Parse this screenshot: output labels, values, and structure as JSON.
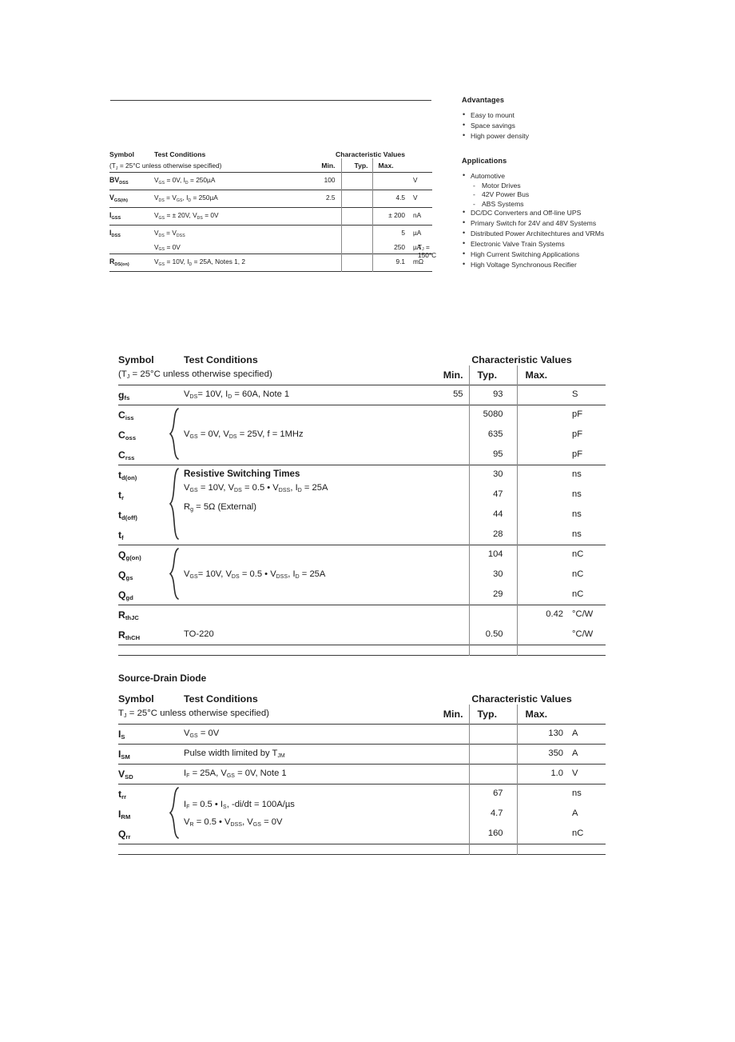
{
  "page": {
    "background": "#ffffff",
    "text_color": "#1b1b1b",
    "rule_color": "#3a3a3a"
  },
  "sidebar": {
    "advantages_heading": "Advantages",
    "advantages": [
      "Easy to mount",
      "Space savings",
      "High power density"
    ],
    "applications_heading": "Applications",
    "applications": [
      {
        "label": "Automotive",
        "sub": [
          "Motor Drives",
          "42V Power Bus",
          "ABS Systems"
        ]
      },
      {
        "label": "DC/DC Converters and Off-line UPS",
        "sub": []
      },
      {
        "label": "Primary Switch for 24V and 48V Systems",
        "sub": []
      },
      {
        "label": "Distributed Power Architechtures and VRMs",
        "sub": []
      },
      {
        "label": "Electronic Valve Train Systems",
        "sub": []
      },
      {
        "label": "High Current Switching Applications",
        "sub": []
      },
      {
        "label": "High Voltage Synchronous Recifier",
        "sub": []
      }
    ]
  },
  "table_small": {
    "header": {
      "symbol": "Symbol",
      "test_conditions": "Test Conditions",
      "subnote_pre": "(T",
      "subnote_sub": "J",
      "subnote_post": " = 25°C unless otherwise specified)",
      "characteristic_values": "Characteristic Values",
      "min": "Min.",
      "typ": "Typ.",
      "max": "Max."
    },
    "rows": [
      {
        "symbol_main": "BV",
        "symbol_sub": "DSS",
        "conditions": [
          {
            "segments": [
              {
                "t": "V",
                "sub": "GS"
              },
              {
                "t": " = 0V, "
              },
              {
                "t": "I",
                "sub": "D"
              },
              {
                "t": " = 250µA"
              }
            ],
            "right": ""
          }
        ],
        "min": "100",
        "typ": "",
        "max": "",
        "unit": "V"
      },
      {
        "symbol_main": "V",
        "symbol_sub": "GS(th)",
        "conditions": [
          {
            "segments": [
              {
                "t": "V",
                "sub": "DS"
              },
              {
                "t": " = V"
              },
              {
                "t": "",
                "sub": "GS"
              },
              {
                "t": ", "
              },
              {
                "t": "I",
                "sub": "D"
              },
              {
                "t": " = 250µA"
              }
            ],
            "right": ""
          }
        ],
        "min": "2.5",
        "typ": "",
        "max": "4.5",
        "unit": "V"
      },
      {
        "symbol_main": "I",
        "symbol_sub": "GSS",
        "conditions": [
          {
            "segments": [
              {
                "t": "V",
                "sub": "GS"
              },
              {
                "t": " = ± 20V, "
              },
              {
                "t": "V",
                "sub": "DS"
              },
              {
                "t": " = 0V"
              }
            ],
            "right": ""
          }
        ],
        "min": "",
        "typ": "",
        "max": "± 200",
        "unit": "nA"
      },
      {
        "symbol_main": "I",
        "symbol_sub": "DSS",
        "conditions": [
          {
            "segments": [
              {
                "t": "V",
                "sub": "DS"
              },
              {
                "t": " =  V"
              },
              {
                "t": "",
                "sub": "DSS"
              }
            ],
            "right": ""
          },
          {
            "segments": [
              {
                "t": "V",
                "sub": "GS"
              },
              {
                "t": " = 0V"
              }
            ],
            "right_segments": [
              {
                "t": "T",
                "sub": "J"
              },
              {
                "t": " = 150°C"
              }
            ]
          }
        ],
        "min": "",
        "typ": "",
        "max": "5",
        "max2": "250",
        "unit": "µA",
        "unit2": "µA"
      },
      {
        "symbol_main": "R",
        "symbol_sub": "DS(on)",
        "conditions": [
          {
            "segments": [
              {
                "t": "V",
                "sub": "GS"
              },
              {
                "t": " = 10V, "
              },
              {
                "t": "I",
                "sub": "D"
              },
              {
                "t": " = 25A, Notes 1, 2"
              }
            ],
            "right": ""
          }
        ],
        "min": "",
        "typ": "",
        "max": "9.1",
        "unit": "mΩ"
      }
    ]
  },
  "table_main": {
    "header": {
      "symbol": "Symbol",
      "test_conditions": "Test Conditions",
      "subnote_pre": "(T",
      "subnote_sub": "J",
      "subnote_post": " = 25°C unless otherwise specified)",
      "characteristic_values": "Characteristic Values",
      "min": "Min.",
      "typ": "Typ.",
      "max": "Max."
    },
    "groups": [
      {
        "braced": false,
        "rows": [
          {
            "symbol_main": "g",
            "symbol_sub": "fs",
            "min": "55",
            "typ": "93",
            "max": "",
            "unit": "S"
          }
        ],
        "conditions": [
          {
            "segments": [
              {
                "t": "V",
                "sub": "DS"
              },
              {
                "t": "= 10V, "
              },
              {
                "t": "I",
                "sub": "D"
              },
              {
                "t": " = 60A, Note 1"
              }
            ]
          }
        ]
      },
      {
        "braced": true,
        "rows": [
          {
            "symbol_main": "C",
            "symbol_sub": "iss",
            "min": "",
            "typ": "5080",
            "max": "",
            "unit": "pF"
          },
          {
            "symbol_main": "C",
            "symbol_sub": "oss",
            "min": "",
            "typ": "635",
            "max": "",
            "unit": "pF"
          },
          {
            "symbol_main": "C",
            "symbol_sub": "rss",
            "min": "",
            "typ": "95",
            "max": "",
            "unit": "pF"
          }
        ],
        "conditions": [
          {
            "segments": [
              {
                "t": "V",
                "sub": "GS"
              },
              {
                "t": " = 0V, "
              },
              {
                "t": "V",
                "sub": "DS"
              },
              {
                "t": " = 25V, f = 1MHz"
              }
            ]
          }
        ]
      },
      {
        "braced": true,
        "section_title": "Resistive Switching Times",
        "rows": [
          {
            "symbol_main": "t",
            "symbol_sub": "d(on)",
            "min": "",
            "typ": "30",
            "max": "",
            "unit": "ns"
          },
          {
            "symbol_main": "t",
            "symbol_sub": "r",
            "min": "",
            "typ": "47",
            "max": "",
            "unit": "ns"
          },
          {
            "symbol_main": "t",
            "symbol_sub": "d(off)",
            "min": "",
            "typ": "44",
            "max": "",
            "unit": "ns"
          },
          {
            "symbol_main": "t",
            "symbol_sub": "f",
            "min": "",
            "typ": "28",
            "max": "",
            "unit": "ns"
          }
        ],
        "conditions": [
          {
            "segments": [
              {
                "t": "V",
                "sub": "GS"
              },
              {
                "t": " = 10V, "
              },
              {
                "t": "V",
                "sub": "DS"
              },
              {
                "t": " = 0.5 • V"
              },
              {
                "t": "",
                "sub": "DSS"
              },
              {
                "t": ", "
              },
              {
                "t": "I",
                "sub": "D"
              },
              {
                "t": " = 25A"
              }
            ]
          },
          {
            "segments": [
              {
                "t": "R",
                "sub": "g"
              },
              {
                "t": " = 5Ω (External)"
              }
            ]
          }
        ]
      },
      {
        "braced": true,
        "rows": [
          {
            "symbol_main": "Q",
            "symbol_sub": "g(on)",
            "min": "",
            "typ": "104",
            "max": "",
            "unit": "nC"
          },
          {
            "symbol_main": "Q",
            "symbol_sub": "gs",
            "min": "",
            "typ": "30",
            "max": "",
            "unit": "nC"
          },
          {
            "symbol_main": "Q",
            "symbol_sub": "gd",
            "min": "",
            "typ": "29",
            "max": "",
            "unit": "nC"
          }
        ],
        "conditions": [
          {
            "segments": [
              {
                "t": "V",
                "sub": "GS"
              },
              {
                "t": "= 10V, "
              },
              {
                "t": "V",
                "sub": "DS"
              },
              {
                "t": " = 0.5 • V"
              },
              {
                "t": "",
                "sub": "DSS"
              },
              {
                "t": ", "
              },
              {
                "t": "I",
                "sub": "D"
              },
              {
                "t": " = 25A"
              }
            ]
          }
        ]
      },
      {
        "braced": false,
        "rows": [
          {
            "symbol_main": "R",
            "symbol_sub": "thJC",
            "min": "",
            "typ": "",
            "max": "0.42",
            "unit": "°C/W",
            "plain_condition": ""
          },
          {
            "symbol_main": "R",
            "symbol_sub": "thCH",
            "min": "",
            "typ": "0.50",
            "max": "",
            "unit": "°C/W",
            "plain_condition": "TO-220"
          }
        ],
        "conditions": []
      }
    ]
  },
  "table_diode": {
    "title": "Source-Drain Diode",
    "header": {
      "symbol": "Symbol",
      "test_conditions": "Test Conditions",
      "subnote_pre": "T",
      "subnote_sub": "J",
      "subnote_post": " = 25°C unless otherwise specified)",
      "characteristic_values": "Characteristic Values",
      "min": "Min.",
      "typ": "Typ.",
      "max": "Max."
    },
    "groups": [
      {
        "braced": false,
        "rows": [
          {
            "symbol_main": "I",
            "symbol_sub": "S",
            "min": "",
            "typ": "",
            "max": "130",
            "unit": "A"
          }
        ],
        "conditions": [
          {
            "segments": [
              {
                "t": "V",
                "sub": "GS"
              },
              {
                "t": " = 0V"
              }
            ]
          }
        ]
      },
      {
        "braced": false,
        "rows": [
          {
            "symbol_main": "I",
            "symbol_sub": "SM",
            "min": "",
            "typ": "",
            "max": "350",
            "unit": "A"
          }
        ],
        "conditions": [
          {
            "segments": [
              {
                "t": "Pulse width limited by T"
              },
              {
                "t": "",
                "sub": "JM"
              }
            ]
          }
        ]
      },
      {
        "braced": false,
        "rows": [
          {
            "symbol_main": "V",
            "symbol_sub": "SD",
            "min": "",
            "typ": "",
            "max": "1.0",
            "unit": "V"
          }
        ],
        "conditions": [
          {
            "segments": [
              {
                "t": "I",
                "sub": "F"
              },
              {
                "t": " = 25A, "
              },
              {
                "t": "V",
                "sub": "GS"
              },
              {
                "t": " = 0V, Note 1"
              }
            ]
          }
        ]
      },
      {
        "braced": true,
        "rows": [
          {
            "symbol_main": "t",
            "symbol_sub": "rr",
            "min": "",
            "typ": "67",
            "max": "",
            "unit": "ns"
          },
          {
            "symbol_main": "I",
            "symbol_sub": "RM",
            "min": "",
            "typ": "4.7",
            "max": "",
            "unit": "A"
          },
          {
            "symbol_main": "Q",
            "symbol_sub": "rr",
            "min": "",
            "typ": "160",
            "max": "",
            "unit": "nC"
          }
        ],
        "conditions": [
          {
            "segments": [
              {
                "t": "I",
                "sub": "F"
              },
              {
                "t": " = 0.5 • I"
              },
              {
                "t": "",
                "sub": "S"
              },
              {
                "t": ", -di/dt = 100A/µs"
              }
            ]
          },
          {
            "segments": [
              {
                "t": "V",
                "sub": "R"
              },
              {
                "t": " = 0.5 • V"
              },
              {
                "t": "",
                "sub": "DSS"
              },
              {
                "t": ", V"
              },
              {
                "t": "",
                "sub": "GS"
              },
              {
                "t": " = 0V"
              }
            ]
          }
        ]
      }
    ]
  }
}
